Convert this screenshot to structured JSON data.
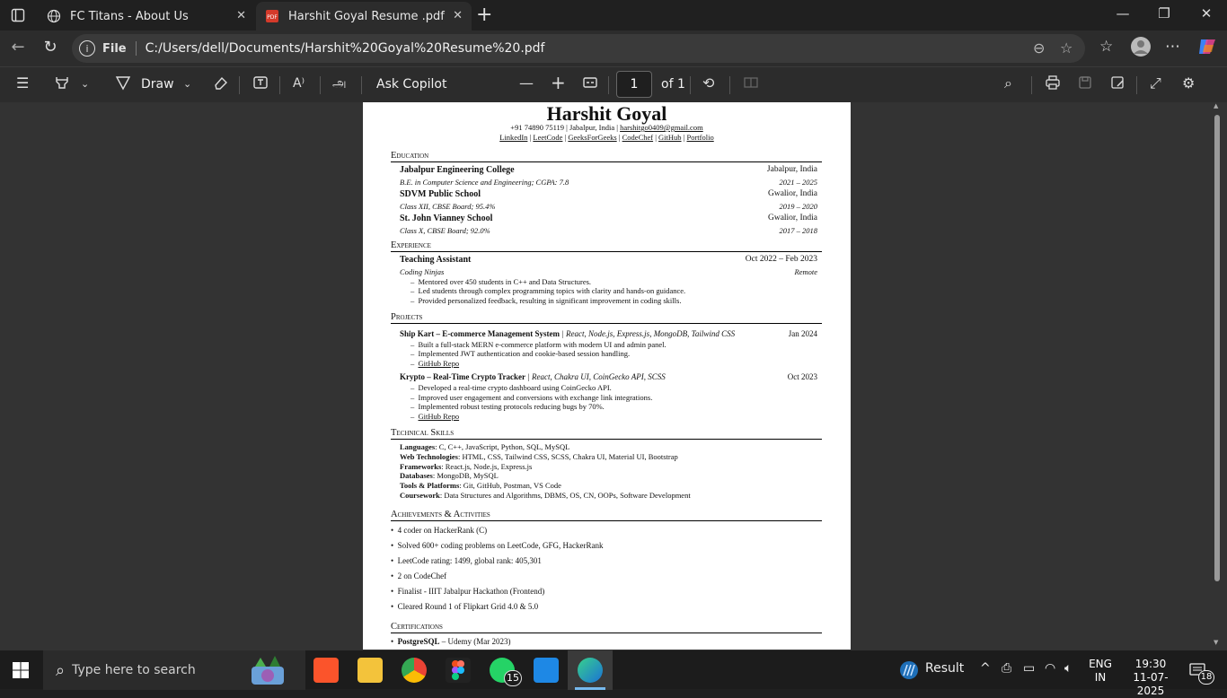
{
  "browser": {
    "tabs": [
      {
        "title": "FC Titans - About Us",
        "active": false
      },
      {
        "title": "Harshit Goyal Resume .pdf",
        "active": true
      }
    ],
    "address": {
      "scheme_label": "File",
      "url": "C:/Users/dell/Documents/Harshit%20Goyal%20Resume%20.pdf"
    }
  },
  "pdf_toolbar": {
    "draw_label": "Draw",
    "copilot_label": "Ask Copilot",
    "page_current": "1",
    "page_total": "of 1"
  },
  "resume": {
    "name": "Harshit Goyal",
    "contact_line": "+91 74890 75119 | Jabalpur, India | ",
    "email": "harshitgo0409@gmail.com",
    "links": [
      "LinkedIn",
      "LeetCode",
      "GeeksForGeeks",
      "CodeChef",
      "GitHub",
      "Portfolio"
    ],
    "sections": {
      "education": "Education",
      "experience": "Experience",
      "projects": "Projects",
      "skills": "Technical Skills",
      "achievements": "Achievements & Activities",
      "certifications": "Certifications"
    },
    "education": [
      {
        "school": "Jabalpur Engineering College",
        "location": "Jabalpur, India",
        "detail": "B.E. in Computer Science and Engineering; CGPA: 7.8",
        "years": "2021 – 2025"
      },
      {
        "school": "SDVM Public School",
        "location": "Gwalior, India",
        "detail": "Class XII, CBSE Board; 95.4%",
        "years": "2019 – 2020"
      },
      {
        "school": "St. John Vianney School",
        "location": "Gwalior, India",
        "detail": "Class X, CBSE Board; 92.0%",
        "years": "2017 – 2018"
      }
    ],
    "experience": {
      "role": "Teaching Assistant",
      "dates": "Oct 2022 – Feb 2023",
      "org": "Coding Ninjas",
      "mode": "Remote",
      "bullets": [
        "Mentored over 450 students in C++ and Data Structures.",
        "Led students through complex programming topics with clarity and hands-on guidance.",
        "Provided personalized feedback, resulting in significant improvement in coding skills."
      ]
    },
    "projects": [
      {
        "title": "Ship Kart – E-commerce Management System",
        "stack": " | React, Node.js, Express.js, MongoDB, Tailwind CSS",
        "date": "Jan 2024",
        "bullets": [
          "Built a full-stack MERN e-commerce platform with modern UI and admin panel.",
          "Implemented JWT authentication and cookie-based session handling."
        ],
        "repo": "GitHub Repo"
      },
      {
        "title": "Krypto – Real-Time Crypto Tracker",
        "stack": " | React, Chakra UI, CoinGecko API, SCSS",
        "date": "Oct 2023",
        "bullets": [
          "Developed a real-time crypto dashboard using CoinGecko API.",
          "Improved user engagement and conversions with exchange link integrations.",
          "Implemented robust testing protocols reducing bugs by 70%."
        ],
        "repo": "GitHub Repo"
      }
    ],
    "skills": [
      {
        "k": "Languages",
        "v": ": C, C++, JavaScript, Python, SQL, MySQL"
      },
      {
        "k": "Web Technologies",
        "v": ": HTML, CSS, Tailwind CSS, SCSS, Chakra UI, Material UI, Bootstrap"
      },
      {
        "k": "Frameworks",
        "v": ": React.js, Node.js, Express.js"
      },
      {
        "k": "Databases",
        "v": ": MongoDB, MySQL"
      },
      {
        "k": "Tools & Platforms",
        "v": ": Git, GitHub, Postman, VS Code"
      },
      {
        "k": "Coursework",
        "v": ": Data Structures and Algorithms, DBMS, OS, CN, OOPs, Software Development"
      }
    ],
    "achievements": [
      "4 coder on HackerRank (C)",
      "Solved 600+ coding problems on LeetCode, GFG, HackerRank",
      "LeetCode rating: 1499, global rank: 405,301",
      "2 on CodeChef",
      "Finalist - IIIT Jabalpur Hackathon (Frontend)",
      "Cleared Round 1 of Flipkart Grid 4.0 & 5.0"
    ],
    "cert": {
      "name": "PostgreSQL",
      "rest": " – Udemy (Mar 2023)"
    }
  },
  "taskbar": {
    "search_placeholder": "Type here to search",
    "whatsapp_badge": "15",
    "weather": "Result",
    "lang_top": "ENG",
    "lang_bottom": "IN",
    "time": "19:30",
    "date": "11-07-2025",
    "notif_count": "18"
  }
}
